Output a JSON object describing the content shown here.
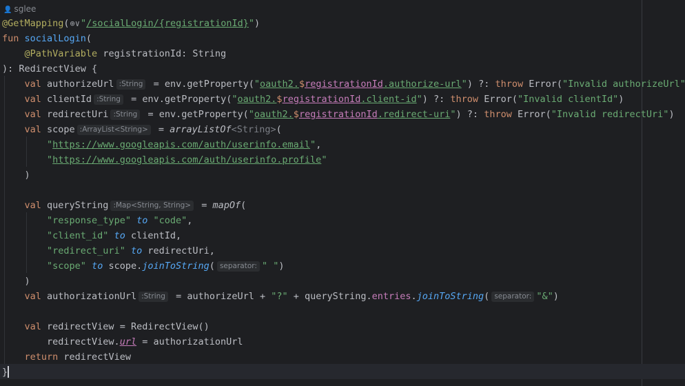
{
  "author": "sglee",
  "lines": [
    [
      {
        "c": "ann",
        "t": "@GetMapping"
      },
      {
        "c": "pl",
        "t": "("
      },
      {
        "c": "globe",
        "t": "⊕∨"
      },
      {
        "c": "str",
        "t": "\""
      },
      {
        "c": "link",
        "t": "/socialLogin/{registrationId}"
      },
      {
        "c": "str",
        "t": "\""
      },
      {
        "c": "pl",
        "t": ")"
      }
    ],
    [
      {
        "c": "kw",
        "t": "fun "
      },
      {
        "c": "fn",
        "t": "socialLogin"
      },
      {
        "c": "pl",
        "t": "("
      }
    ],
    [
      {
        "c": "pl",
        "t": "    "
      },
      {
        "c": "ann",
        "t": "@PathVariable"
      },
      {
        "c": "pl",
        "t": " registrationId: String"
      }
    ],
    [
      {
        "c": "pl",
        "t": "): RedirectView {"
      }
    ],
    [
      {
        "c": "pl",
        "t": "    "
      },
      {
        "c": "kw",
        "t": "val "
      },
      {
        "c": "pl",
        "t": "authorizeUrl"
      },
      {
        "c": "hint",
        "t": ":String"
      },
      {
        "c": "pl",
        "t": " = env.getProperty("
      },
      {
        "c": "str",
        "t": "\""
      },
      {
        "c": "link",
        "t": "oauth2."
      },
      {
        "c": "dlr",
        "t": "$"
      },
      {
        "c": "tpl",
        "t": "registrationId"
      },
      {
        "c": "link",
        "t": ".authorize-url"
      },
      {
        "c": "str",
        "t": "\""
      },
      {
        "c": "pl",
        "t": ") ?: "
      },
      {
        "c": "kw",
        "t": "throw "
      },
      {
        "c": "pl",
        "t": "Error("
      },
      {
        "c": "str",
        "t": "\"Invalid authorizeUrl\""
      },
      {
        "c": "pl",
        "t": ")"
      }
    ],
    [
      {
        "c": "pl",
        "t": "    "
      },
      {
        "c": "kw",
        "t": "val "
      },
      {
        "c": "pl",
        "t": "clientId"
      },
      {
        "c": "hint",
        "t": ":String"
      },
      {
        "c": "pl",
        "t": " = env.getProperty("
      },
      {
        "c": "str",
        "t": "\""
      },
      {
        "c": "link",
        "t": "oauth2."
      },
      {
        "c": "dlr",
        "t": "$"
      },
      {
        "c": "tpl",
        "t": "registrationId"
      },
      {
        "c": "link",
        "t": ".client-id"
      },
      {
        "c": "str",
        "t": "\""
      },
      {
        "c": "pl",
        "t": ") ?: "
      },
      {
        "c": "kw",
        "t": "throw "
      },
      {
        "c": "pl",
        "t": "Error("
      },
      {
        "c": "str",
        "t": "\"Invalid clientId\""
      },
      {
        "c": "pl",
        "t": ")"
      }
    ],
    [
      {
        "c": "pl",
        "t": "    "
      },
      {
        "c": "kw",
        "t": "val "
      },
      {
        "c": "pl",
        "t": "redirectUri"
      },
      {
        "c": "hint",
        "t": ":String"
      },
      {
        "c": "pl",
        "t": " = env.getProperty("
      },
      {
        "c": "str",
        "t": "\""
      },
      {
        "c": "link",
        "t": "oauth2."
      },
      {
        "c": "dlr",
        "t": "$"
      },
      {
        "c": "tpl",
        "t": "registrationId"
      },
      {
        "c": "link",
        "t": ".redirect-uri"
      },
      {
        "c": "str",
        "t": "\""
      },
      {
        "c": "pl",
        "t": ") ?: "
      },
      {
        "c": "kw",
        "t": "throw "
      },
      {
        "c": "pl",
        "t": "Error("
      },
      {
        "c": "str",
        "t": "\"Invalid redirectUri\""
      },
      {
        "c": "pl",
        "t": ")"
      }
    ],
    [
      {
        "c": "pl",
        "t": "    "
      },
      {
        "c": "kw",
        "t": "val "
      },
      {
        "c": "pl",
        "t": "scope"
      },
      {
        "c": "hint",
        "t": ":ArrayList<String>"
      },
      {
        "c": "pl",
        "t": " = "
      },
      {
        "c": "it",
        "t": "arrayListOf"
      },
      {
        "c": "gen",
        "t": "<String>"
      },
      {
        "c": "pl",
        "t": "("
      }
    ],
    [
      {
        "c": "pl",
        "t": "        "
      },
      {
        "c": "str",
        "t": "\""
      },
      {
        "c": "link",
        "t": "https://www.googleapis.com/auth/userinfo.email"
      },
      {
        "c": "str",
        "t": "\""
      },
      {
        "c": "pl",
        "t": ","
      }
    ],
    [
      {
        "c": "pl",
        "t": "        "
      },
      {
        "c": "str",
        "t": "\""
      },
      {
        "c": "link",
        "t": "https://www.googleapis.com/auth/userinfo.profile"
      },
      {
        "c": "str",
        "t": "\""
      }
    ],
    [
      {
        "c": "pl",
        "t": "    )"
      }
    ],
    [],
    [
      {
        "c": "pl",
        "t": "    "
      },
      {
        "c": "kw",
        "t": "val "
      },
      {
        "c": "pl",
        "t": "queryString"
      },
      {
        "c": "hint",
        "t": ":Map<String, String>"
      },
      {
        "c": "pl",
        "t": " = "
      },
      {
        "c": "it",
        "t": "mapOf"
      },
      {
        "c": "pl",
        "t": "("
      }
    ],
    [
      {
        "c": "pl",
        "t": "        "
      },
      {
        "c": "str",
        "t": "\"response_type\""
      },
      {
        "c": "pl",
        "t": " "
      },
      {
        "c": "itfn",
        "t": "to"
      },
      {
        "c": "pl",
        "t": " "
      },
      {
        "c": "str",
        "t": "\"code\""
      },
      {
        "c": "pl",
        "t": ","
      }
    ],
    [
      {
        "c": "pl",
        "t": "        "
      },
      {
        "c": "str",
        "t": "\"client_id\""
      },
      {
        "c": "pl",
        "t": " "
      },
      {
        "c": "itfn",
        "t": "to"
      },
      {
        "c": "pl",
        "t": " clientId,"
      }
    ],
    [
      {
        "c": "pl",
        "t": "        "
      },
      {
        "c": "str",
        "t": "\"redirect_uri\""
      },
      {
        "c": "pl",
        "t": " "
      },
      {
        "c": "itfn",
        "t": "to"
      },
      {
        "c": "pl",
        "t": " redirectUri,"
      }
    ],
    [
      {
        "c": "pl",
        "t": "        "
      },
      {
        "c": "str",
        "t": "\"scope\""
      },
      {
        "c": "pl",
        "t": " "
      },
      {
        "c": "itfn",
        "t": "to"
      },
      {
        "c": "pl",
        "t": " scope."
      },
      {
        "c": "itfn",
        "t": "joinToString"
      },
      {
        "c": "pl",
        "t": "("
      },
      {
        "c": "hint",
        "t": "separator:"
      },
      {
        "c": "str",
        "t": "\" \""
      },
      {
        "c": "pl",
        "t": ")"
      }
    ],
    [
      {
        "c": "pl",
        "t": "    )"
      }
    ],
    [
      {
        "c": "pl",
        "t": "    "
      },
      {
        "c": "kw",
        "t": "val "
      },
      {
        "c": "pl",
        "t": "authorizationUrl"
      },
      {
        "c": "hint",
        "t": ":String"
      },
      {
        "c": "pl",
        "t": " = authorizeUrl + "
      },
      {
        "c": "str",
        "t": "\"?\""
      },
      {
        "c": "pl",
        "t": " + queryString."
      },
      {
        "c": "prop",
        "t": "entries"
      },
      {
        "c": "pl",
        "t": "."
      },
      {
        "c": "itfn",
        "t": "joinToString"
      },
      {
        "c": "pl",
        "t": "("
      },
      {
        "c": "hint",
        "t": "separator:"
      },
      {
        "c": "str",
        "t": "\"&\""
      },
      {
        "c": "pl",
        "t": ")"
      }
    ],
    [],
    [
      {
        "c": "pl",
        "t": "    "
      },
      {
        "c": "kw",
        "t": "val "
      },
      {
        "c": "pl",
        "t": "redirectView = RedirectView()"
      }
    ],
    [
      {
        "c": "pl",
        "t": "        redirectView."
      },
      {
        "c": "propu",
        "t": "url"
      },
      {
        "c": "pl",
        "t": " = authorizationUrl"
      }
    ],
    [
      {
        "c": "pl",
        "t": "    "
      },
      {
        "c": "kw",
        "t": "return "
      },
      {
        "c": "pl",
        "t": "redirectView"
      }
    ],
    [
      {
        "c": "pl",
        "t": "}"
      }
    ]
  ]
}
